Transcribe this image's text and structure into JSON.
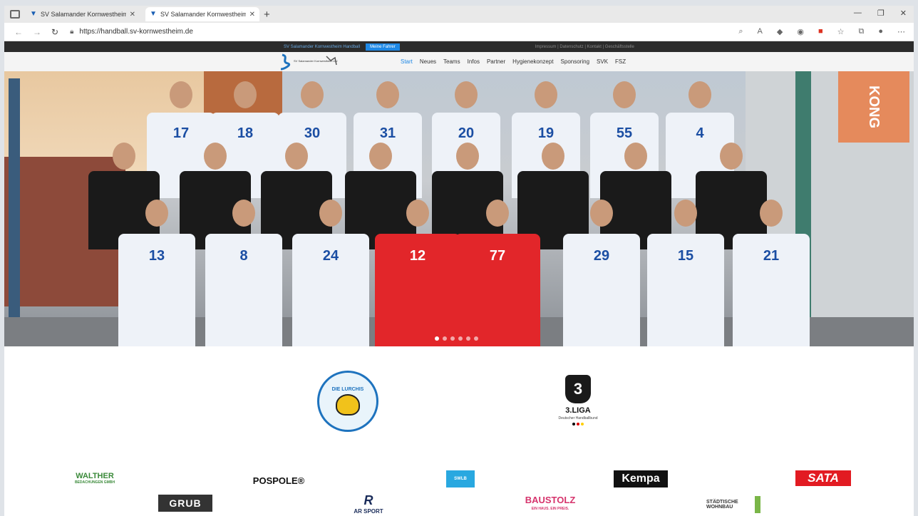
{
  "browser": {
    "tabs": [
      {
        "title": "SV Salamander Kornwestheim Handball",
        "active": false
      },
      {
        "title": "SV Salamander Kornwestheim Handball",
        "active": true
      }
    ],
    "url": "https://handball.sv-kornwestheim.de",
    "icons": [
      "back-icon",
      "forward-icon",
      "refresh-icon",
      "lock-icon",
      "zoom-icon",
      "read-aloud-icon",
      "extension-icon",
      "favorites-icon",
      "collections-icon",
      "profile-icon",
      "more-icon"
    ]
  },
  "site": {
    "topbar": {
      "club": "SV Salamander Kornwestheim Handball",
      "mail_button": "Meine Fahrer",
      "meta": "Impressum | Datenschutz | Kontakt | Geschäftsstelle"
    },
    "logo_text": "SV Salamander Kornwestheim e.V.",
    "menu": [
      "Start",
      "Neues",
      "Teams",
      "Infos",
      "Partner",
      "Hygienekonzept",
      "Sponsoring",
      "SVK",
      "FSZ"
    ],
    "active_menu": "Start",
    "flag_text": "KONG",
    "jersey_numbers_back": [
      "17",
      "18",
      "30",
      "31",
      "20",
      "19",
      "55",
      "4"
    ],
    "jersey_numbers_front": [
      "13",
      "8",
      "24",
      "12",
      "77",
      "29",
      "15",
      "21"
    ],
    "slider_dots": 6,
    "slider_active": 0
  },
  "logos": {
    "lurchis": "DIE LURCHIS",
    "liga_name": "3.LIGA",
    "liga_sub": "Deutscher Handballbund"
  },
  "sponsors": {
    "walther": "WALTHER",
    "walther_sub": "BEDACHUNGEN GMBH",
    "pospole": "POSPOLE®",
    "swlb": "SWLB",
    "kempa": "Kempa",
    "sata": "SATA",
    "grub": "GRUB",
    "arsport_mark": "R",
    "arsport": "AR SPORT",
    "baustolz": "BAUSTOLZ",
    "baustolz_sub": "EIN HAUS. EIN PREIS.",
    "wohnbau": "STÄDTISCHE WOHNBAU"
  }
}
